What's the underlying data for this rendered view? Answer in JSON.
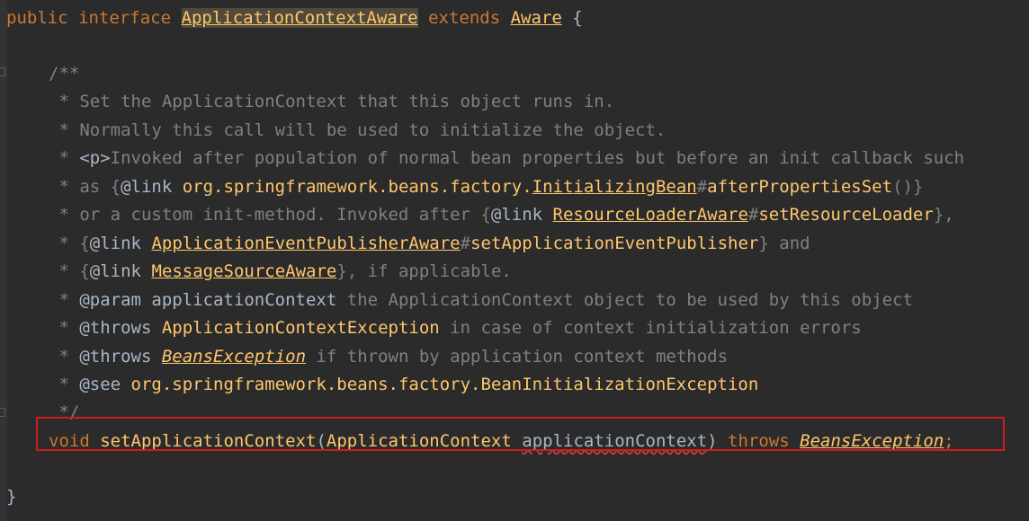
{
  "code": {
    "line1": {
      "kw_public": "public",
      "kw_interface": "interface",
      "name": "ApplicationContextAware",
      "kw_extends": "extends",
      "parent": "Aware",
      "brace": "{"
    },
    "doc": {
      "open": "/**",
      "l1": " * Set the ApplicationContext that this object runs in.",
      "l2": " * Normally this call will be used to initialize the object.",
      "l3_star": " * ",
      "l3_tag": "<p>",
      "l3_text": "Invoked after population of normal bean properties but before an init callback such",
      "l4_star": " * as ",
      "l4_open": "{",
      "l4_link": "@link",
      "l4_pkg": " org.springframework.beans.factory.",
      "l4_ref": "InitializingBean",
      "l4_hash": "#",
      "l4_method": "afterPropertiesSet",
      "l4_close": "()}",
      "l5_text": " * or a custom init-method. Invoked after ",
      "l5_open": "{",
      "l5_link": "@link",
      "l5_sp": " ",
      "l5_ref": "ResourceLoaderAware",
      "l5_hash": "#",
      "l5_method": "setResourceLoader",
      "l5_close": "},",
      "l6_star": " * ",
      "l6_open": "{",
      "l6_link": "@link",
      "l6_sp": " ",
      "l6_ref": "ApplicationEventPublisherAware",
      "l6_hash": "#",
      "l6_method": "setApplicationEventPublisher",
      "l6_close": "}",
      "l6_and": " and",
      "l7_star": " * ",
      "l7_open": "{",
      "l7_link": "@link",
      "l7_sp": " ",
      "l7_ref": "MessageSourceAware",
      "l7_close": "}",
      "l7_rest": ", if applicable.",
      "l8_star": " * ",
      "l8_tag": "@param",
      "l8_param": " applicationContext",
      "l8_rest": " the ApplicationContext object to be used by this object",
      "l9_star": " * ",
      "l9_tag": "@throws",
      "l9_ref": " ApplicationContextException",
      "l9_rest": " in case of context initialization errors",
      "l10_star": " * ",
      "l10_tag": "@throws",
      "l10_sp": " ",
      "l10_ref": "BeansException",
      "l10_rest": " if thrown by application context methods",
      "l11_star": " * ",
      "l11_tag": "@see",
      "l11_ref": " org.springframework.beans.factory.BeanInitializationException",
      "close": " */"
    },
    "method": {
      "kw_void": "void",
      "name": " setApplicationContext",
      "lparen": "(",
      "param_type": "ApplicationContext",
      "sp": " ",
      "param_name": "applicationContext",
      "rparen": ")",
      "kw_throws": " throws ",
      "exception": "BeansException",
      "semi": ";"
    },
    "closing_brace": "}"
  },
  "colors": {
    "background": "#2b2b2b",
    "keyword": "#cc7832",
    "type": "#ffc66d",
    "doc_comment": "#629755",
    "comment_gray": "#808080",
    "highlight_box": "#d11c1c"
  }
}
